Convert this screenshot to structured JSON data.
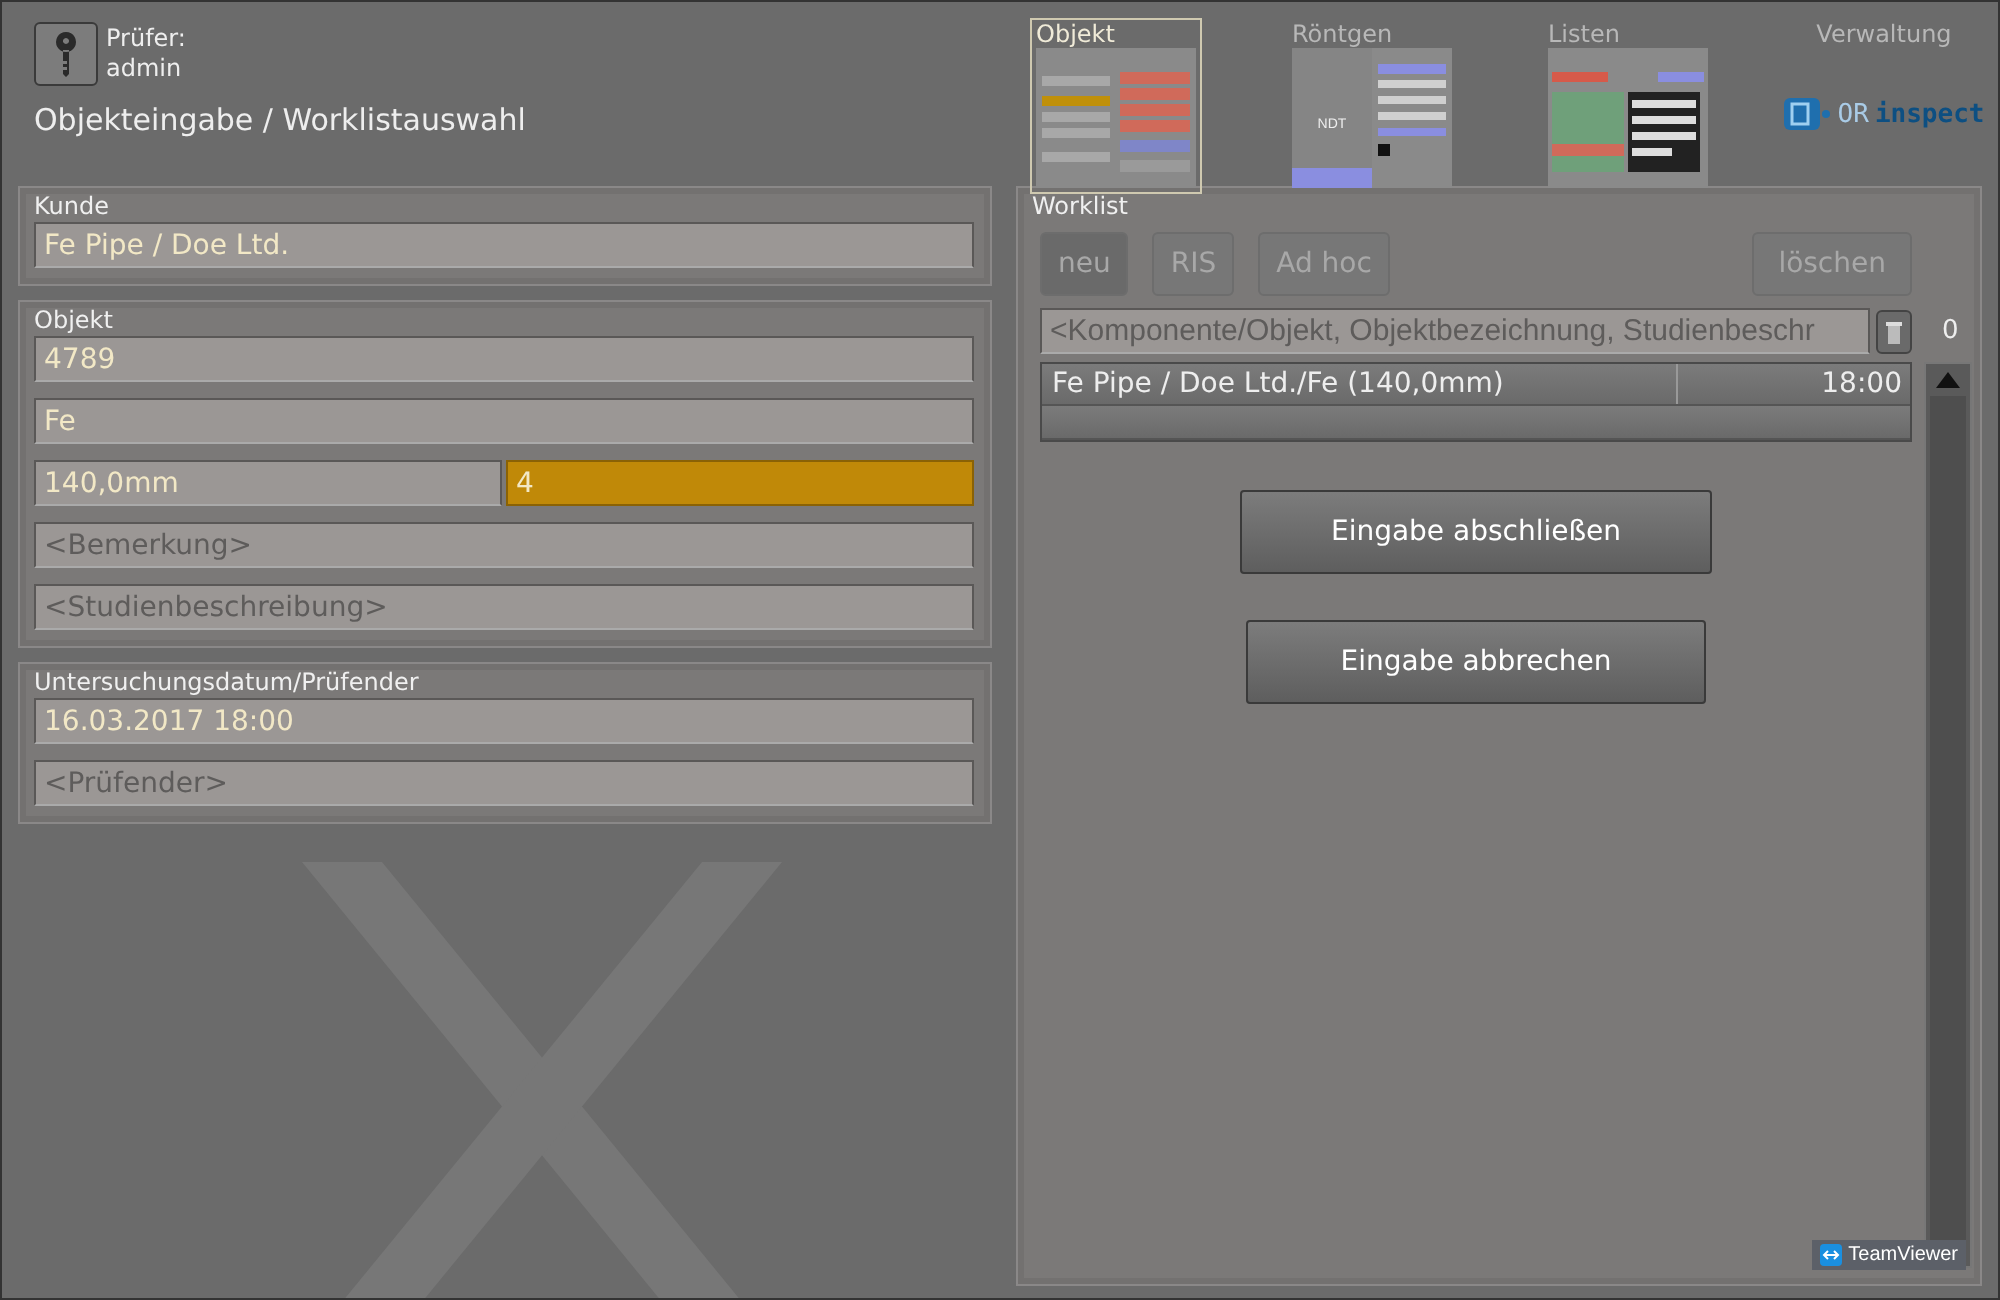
{
  "header": {
    "user_label": "Prüfer:",
    "user_name": "admin",
    "title": "Objekteingabe / Worklistauswahl"
  },
  "nav_tabs": [
    {
      "label": "Objekt",
      "selected": true,
      "kind": "form"
    },
    {
      "label": "Röntgen",
      "selected": false,
      "kind": "ndt",
      "caption": "NDT"
    },
    {
      "label": "Listen",
      "selected": false,
      "kind": "lists"
    },
    {
      "label": "Verwaltung",
      "selected": false,
      "kind": "logo",
      "logo_left": "OR",
      "logo_right": "inspect"
    }
  ],
  "customer": {
    "title": "Kunde",
    "value": "Fe Pipe / Doe Ltd."
  },
  "object": {
    "title": "Objekt",
    "id": "4789",
    "material": "Fe",
    "diameter": "140,0mm",
    "wall": {
      "value": "4",
      "focused": true
    },
    "remark_placeholder": "<Bemerkung>",
    "study_placeholder": "<Studienbeschreibung>"
  },
  "exam": {
    "title": "Untersuchungsdatum/Prüfender",
    "date": "16.03.2017 18:00",
    "examiner_placeholder": "<Prüfender>"
  },
  "worklist": {
    "title": "Worklist",
    "buttons": [
      {
        "label": "neu",
        "selected": true
      },
      {
        "label": "RIS",
        "selected": false
      },
      {
        "label": "Ad hoc",
        "selected": false
      },
      {
        "label": "löschen",
        "selected": false
      }
    ],
    "filter_placeholder": "<Komponente/Objekt, Objektbezeichnung, Studienbeschr",
    "count": "0",
    "rows": [
      {
        "name": "Fe Pipe / Doe Ltd./Fe (140,0mm)",
        "time": "18:00",
        "selected": false
      }
    ],
    "actions": [
      "Eingabe abschließen",
      "Eingabe abbrechen"
    ]
  },
  "overlay": {
    "badge": "TeamViewer"
  }
}
